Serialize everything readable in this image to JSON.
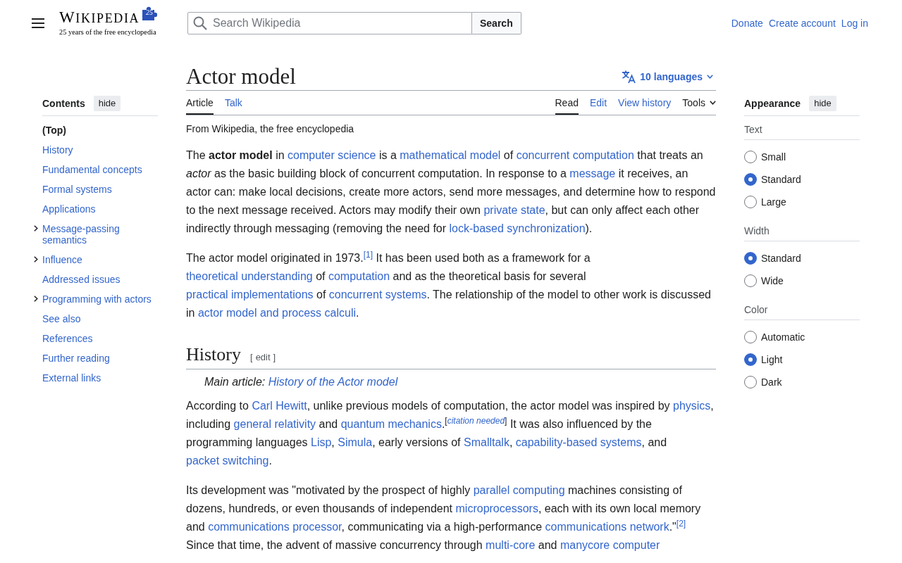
{
  "header": {
    "wordmark": "WIKIPEDIA",
    "logo_badge": "25",
    "tagline": "25 years of the free encyclopedia",
    "search": {
      "placeholder": "Search Wikipedia",
      "button": "Search"
    },
    "user_links": [
      "Donate",
      "Create account",
      "Log in"
    ]
  },
  "toc": {
    "title": "Contents",
    "hide_button": "hide",
    "items": [
      {
        "label": "(Top)",
        "kind": "section",
        "selected": true
      },
      {
        "label": "History",
        "kind": "section",
        "selected": false
      },
      {
        "label": "Fundamental concepts",
        "kind": "section",
        "selected": false
      },
      {
        "label": "Formal systems",
        "kind": "section",
        "selected": false
      },
      {
        "label": "Applications",
        "kind": "section",
        "selected": false
      },
      {
        "label": "Message-passing semantics",
        "kind": "parent",
        "selected": false
      },
      {
        "label": "Influence",
        "kind": "parent",
        "selected": false
      },
      {
        "label": "Addressed issues",
        "kind": "section",
        "selected": false
      },
      {
        "label": "Programming with actors",
        "kind": "parent",
        "selected": false
      },
      {
        "label": "See also",
        "kind": "section",
        "selected": false
      },
      {
        "label": "References",
        "kind": "section",
        "selected": false
      },
      {
        "label": "Further reading",
        "kind": "section",
        "selected": false
      },
      {
        "label": "External links",
        "kind": "section",
        "selected": false
      }
    ]
  },
  "article": {
    "title": "Actor model",
    "languages": "10 languages",
    "tabs": [
      {
        "label": "Article",
        "selected": true
      },
      {
        "label": "Talk",
        "selected": false
      }
    ],
    "views": [
      {
        "label": "Read",
        "kind": "tab",
        "selected": true
      },
      {
        "label": "Edit",
        "kind": "tab",
        "selected": false
      },
      {
        "label": "View history",
        "kind": "tab",
        "selected": false
      },
      {
        "label": "Tools",
        "kind": "menu",
        "selected": false
      }
    ],
    "tagline": "From Wikipedia, the free encyclopedia",
    "intro": [
      [
        {
          "kind": "text",
          "text": "The **actor model** in "
        },
        {
          "kind": "link",
          "text": "computer science"
        },
        {
          "kind": "text",
          "text": " is a "
        },
        {
          "kind": "link",
          "text": "mathematical model"
        },
        {
          "kind": "text",
          "text": " of "
        },
        {
          "kind": "link",
          "text": "concurrent computation"
        },
        {
          "kind": "text",
          "text": " that treats an *actor* as the basic building block of concurrent computation. In response to a "
        },
        {
          "kind": "link",
          "text": "message"
        },
        {
          "kind": "text",
          "text": " it receives, an actor can: make local decisions, create more actors, send more messages, and determine how to respond to the next message received. Actors may modify their own "
        },
        {
          "kind": "link",
          "text": "private state"
        },
        {
          "kind": "text",
          "text": ", but can only affect each other indirectly through messaging (removing the need for "
        },
        {
          "kind": "link",
          "text": "lock-based synchronization"
        },
        {
          "kind": "text",
          "text": ")."
        }
      ],
      [
        {
          "kind": "text",
          "text": "The actor model originated in 1973."
        },
        {
          "kind": "ref",
          "text": "[1]"
        },
        {
          "kind": "text",
          "text": " It has been used both as a framework for a "
        },
        {
          "kind": "link",
          "text": "theoretical understanding"
        },
        {
          "kind": "text",
          "text": " of "
        },
        {
          "kind": "link",
          "text": "computation"
        },
        {
          "kind": "text",
          "text": " and as the theoretical basis for several "
        },
        {
          "kind": "link",
          "text": "practical implementations"
        },
        {
          "kind": "text",
          "text": " of "
        },
        {
          "kind": "link",
          "text": "concurrent systems"
        },
        {
          "kind": "text",
          "text": ". The relationship of the model to other work is discussed in "
        },
        {
          "kind": "link",
          "text": "actor model and process calculi"
        },
        {
          "kind": "text",
          "text": "."
        }
      ]
    ],
    "sections": [
      {
        "heading": "History",
        "edit": {
          "open": "[",
          "label": "edit",
          "close": "]"
        },
        "hatnote": [
          {
            "kind": "text",
            "text": "Main article: "
          },
          {
            "kind": "link",
            "text": "History of the Actor model"
          }
        ],
        "paragraphs": [
          [
            {
              "kind": "text",
              "text": "According to "
            },
            {
              "kind": "link",
              "text": "Carl Hewitt"
            },
            {
              "kind": "text",
              "text": ", unlike previous models of computation, the actor model was inspired by "
            },
            {
              "kind": "link",
              "text": "physics"
            },
            {
              "kind": "text",
              "text": ", including "
            },
            {
              "kind": "link",
              "text": "general relativity"
            },
            {
              "kind": "text",
              "text": " and "
            },
            {
              "kind": "link",
              "text": "quantum mechanics"
            },
            {
              "kind": "text",
              "text": ".$^{[}$"
            },
            {
              "kind": "note",
              "text": "citation needed"
            },
            {
              "kind": "text",
              "text": "$^{]}$ It was also influenced by the programming languages "
            },
            {
              "kind": "link",
              "text": "Lisp"
            },
            {
              "kind": "text",
              "text": ", "
            },
            {
              "kind": "link",
              "text": "Simula"
            },
            {
              "kind": "text",
              "text": ", early versions of "
            },
            {
              "kind": "link",
              "text": "Smalltalk"
            },
            {
              "kind": "text",
              "text": ", "
            },
            {
              "kind": "link",
              "text": "capability-based systems"
            },
            {
              "kind": "text",
              "text": ", and "
            },
            {
              "kind": "link",
              "text": "packet switching"
            },
            {
              "kind": "text",
              "text": "."
            }
          ],
          [
            {
              "kind": "text",
              "text": "Its development was \"motivated by the prospect of highly "
            },
            {
              "kind": "link",
              "text": "parallel computing"
            },
            {
              "kind": "text",
              "text": " machines consisting of dozens, hundreds, or even thousands of independent "
            },
            {
              "kind": "link",
              "text": "microprocessors"
            },
            {
              "kind": "text",
              "text": ", each with its own local memory and "
            },
            {
              "kind": "link",
              "text": "communications processor"
            },
            {
              "kind": "text",
              "text": ", communicating via a high-performance "
            },
            {
              "kind": "link",
              "text": "communications network"
            },
            {
              "kind": "text",
              "text": ".\""
            },
            {
              "kind": "ref",
              "text": "[2]"
            },
            {
              "kind": "text",
              "text": " Since that time, the advent of massive concurrency through "
            },
            {
              "kind": "link",
              "text": "multi-core"
            },
            {
              "kind": "text",
              "text": " and "
            },
            {
              "kind": "link",
              "text": "manycore computer"
            }
          ]
        ]
      }
    ]
  },
  "appearance": {
    "title": "Appearance",
    "hide_button": "hide",
    "groups": [
      {
        "label": "Text",
        "options": [
          {
            "label": "Small",
            "selected": false
          },
          {
            "label": "Standard",
            "selected": true
          },
          {
            "label": "Large",
            "selected": false
          }
        ]
      },
      {
        "label": "Width",
        "options": [
          {
            "label": "Standard",
            "selected": true
          },
          {
            "label": "Wide",
            "selected": false
          }
        ]
      },
      {
        "label": "Color",
        "options": [
          {
            "label": "Automatic",
            "selected": false
          },
          {
            "label": "Light",
            "selected": true
          },
          {
            "label": "Dark",
            "selected": false
          }
        ]
      }
    ]
  }
}
